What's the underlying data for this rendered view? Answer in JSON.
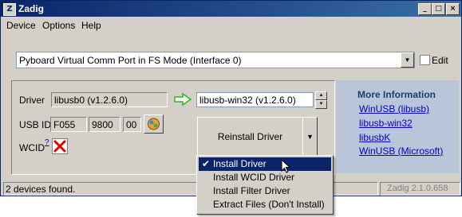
{
  "window": {
    "title": "Zadig",
    "controls": [
      "_",
      "□",
      "×"
    ]
  },
  "menu_bar": [
    "Device",
    "Options",
    "Help"
  ],
  "device_select": {
    "value": "Pyboard Virtual Comm Port in FS Mode (Interface 0)",
    "edit_label": "Edit",
    "edit_checked": false
  },
  "driver_section": {
    "driver_label": "Driver",
    "current_driver": "libusb0 (v1.2.6.0)",
    "target_driver": "libusb-win32 (v1.2.6.0)",
    "usb_id_label": "USB ID",
    "usb_id": [
      "F055",
      "9800",
      "00"
    ],
    "wcid_label": "WCID",
    "wcid_help": "?",
    "reinstall_label": "Reinstall Driver"
  },
  "install_menu": {
    "items": [
      {
        "label": "Install Driver",
        "checked": true,
        "highlighted": true
      },
      {
        "label": "Install WCID Driver",
        "checked": false,
        "highlighted": false
      },
      {
        "label": "Install Filter Driver",
        "checked": false,
        "highlighted": false
      },
      {
        "label": "Extract Files (Don't Install)",
        "checked": false,
        "highlighted": false
      }
    ]
  },
  "info_panel": {
    "heading": "More Information",
    "links": [
      "WinUSB (libusb)",
      "libusb-win32",
      "libusbK",
      "WinUSB (Microsoft)"
    ]
  },
  "status_bar": {
    "message": "2 devices found.",
    "version": "Zadig 2.1.0.658"
  },
  "icons": {
    "arrow": "green-right-arrow-icon",
    "wcid": "red-x-icon",
    "edit_id": "edit-usb-id-icon",
    "cursor": "mouse-pointer-icon"
  },
  "colors": {
    "titlebar": "#0a246a",
    "highlight": "#0a246a",
    "info_panel_bg": "#b9c6d9",
    "link": "#0000cc",
    "arrow": "#2fb52f",
    "wcid_x": "#e00000"
  }
}
